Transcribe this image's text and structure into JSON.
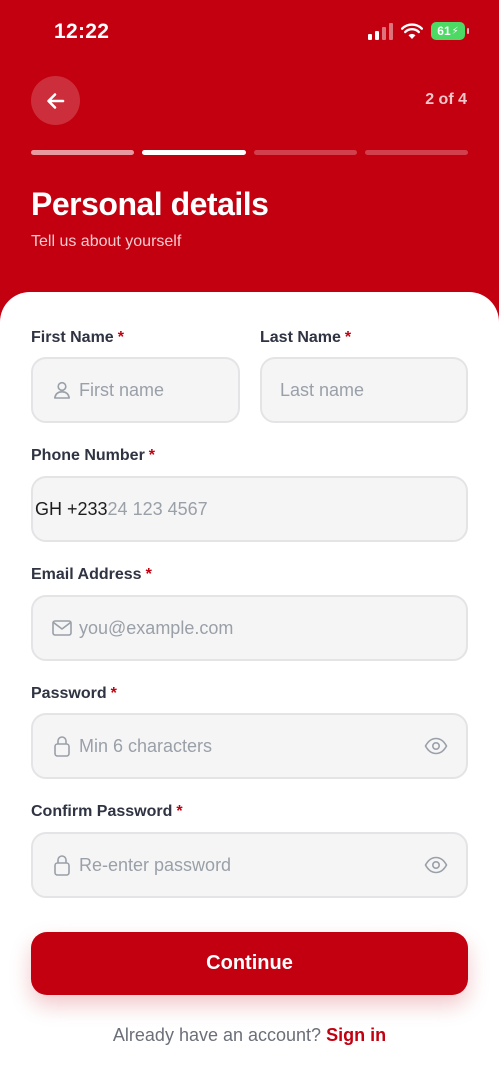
{
  "status_bar": {
    "time": "12:22",
    "battery": "61"
  },
  "header": {
    "step_text": "2 of 4",
    "progress": {
      "total_steps": 4,
      "current_step": 2
    },
    "title": "Personal details",
    "subtitle": "Tell us about yourself"
  },
  "form": {
    "first_name": {
      "label": "First Name",
      "placeholder": "First name",
      "value": ""
    },
    "last_name": {
      "label": "Last Name",
      "placeholder": "Last name",
      "value": ""
    },
    "phone": {
      "label": "Phone Number",
      "country_code": "GH +233",
      "placeholder": "24 123 4567",
      "value": ""
    },
    "email": {
      "label": "Email Address",
      "placeholder": "you@example.com",
      "value": ""
    },
    "password": {
      "label": "Password",
      "placeholder": "Min 6 characters",
      "value": ""
    },
    "confirm_password": {
      "label": "Confirm Password",
      "placeholder": "Re-enter password",
      "value": ""
    },
    "required_mark": "*"
  },
  "actions": {
    "continue_label": "Continue",
    "signin_prompt": "Already have an account?",
    "signin_link": "Sign in"
  },
  "colors": {
    "brand": "#c20010",
    "battery": "#4cd964",
    "input_bg": "#f5f5f6",
    "placeholder": "#9aa0a8"
  },
  "icons": [
    "back-arrow-icon",
    "signal-icon",
    "wifi-icon",
    "battery-icon",
    "user-icon",
    "mail-icon",
    "lock-icon",
    "eye-icon"
  ]
}
